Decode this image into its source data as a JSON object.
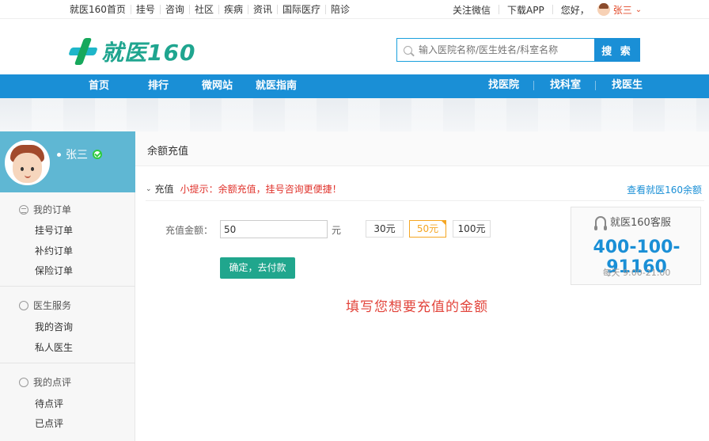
{
  "topbar": {
    "nav": [
      "就医160首页",
      "挂号",
      "咨询",
      "社区",
      "疾病",
      "资讯",
      "国际医疗",
      "陪诊"
    ],
    "follow_wechat": "关注微信",
    "download_app": "下载APP",
    "greeting": "您好，",
    "username": "张三",
    "dropdown_icon": "chevron-down-icon"
  },
  "header": {
    "logo_text": "就医160",
    "search_placeholder": "输入医院名称/医生姓名/科室名称",
    "search_button": "搜 索"
  },
  "mainnav": {
    "left": [
      "首页",
      "排行",
      "微网站",
      "就医指南"
    ],
    "right": [
      "找医院",
      "找科室",
      "找医生"
    ]
  },
  "sidebar": {
    "profile_name": "张三",
    "groups": [
      {
        "title": "我的订单",
        "icon": "list-icon",
        "items": [
          "挂号订单",
          "补约订单",
          "保险订单"
        ]
      },
      {
        "title": "医生服务",
        "icon": "chat-icon",
        "items": [
          "我的咨询",
          "私人医生"
        ]
      },
      {
        "title": "我的点评",
        "icon": "heart-icon",
        "items": [
          "待点评",
          "已点评"
        ]
      }
    ]
  },
  "content": {
    "title": "余额充值",
    "section_label": "充值",
    "tip": "小提示：余额充值，挂号咨询更便捷！",
    "balance_link": "查看就医160余额",
    "amount_label": "充值金额：",
    "amount_value": "50",
    "unit": "元",
    "options": [
      "30元",
      "50元",
      "100元"
    ],
    "selected_option": "50元",
    "pay_button": "确定，去付款",
    "hint": "填写您想要充值的金额"
  },
  "service": {
    "title": "就医160客服",
    "phone": "400-100-91160",
    "hours": "每天 9:00-21:00"
  },
  "colors": {
    "nav_blue": "#1a8fd6",
    "brand_green": "#1fa58f",
    "pay_green": "#20a68d",
    "alert_red": "#e0332c",
    "selected_orange": "#f5a623"
  }
}
